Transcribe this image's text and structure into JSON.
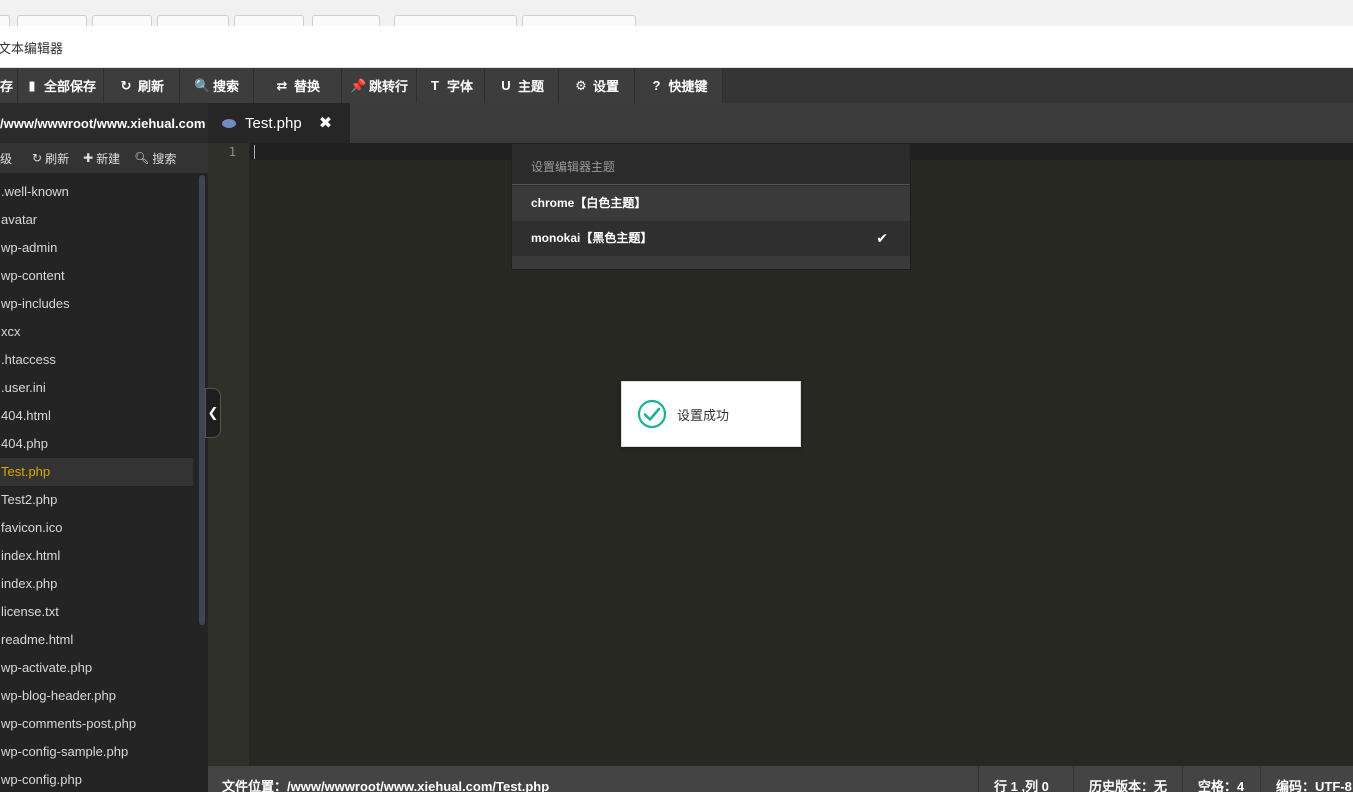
{
  "window": {
    "title": "文本编辑器"
  },
  "toolbar": [
    {
      "id": "save-all",
      "icon": "save-icon",
      "glyph": "▮",
      "label": "全部保存"
    },
    {
      "id": "refresh",
      "icon": "refresh-icon",
      "glyph": "↻",
      "label": "刷新"
    },
    {
      "id": "search",
      "icon": "search-icon",
      "glyph": "🔍",
      "label": "搜索"
    },
    {
      "id": "replace",
      "icon": "replace-icon",
      "glyph": "⇄",
      "label": "替换"
    },
    {
      "id": "goto-line",
      "icon": "pin-icon",
      "glyph": "📌",
      "label": "跳转行"
    },
    {
      "id": "font",
      "icon": "font-icon",
      "glyph": "T",
      "label": "字体"
    },
    {
      "id": "theme",
      "icon": "magnet-icon",
      "glyph": "U",
      "label": "主题"
    },
    {
      "id": "settings",
      "icon": "gear-icon",
      "glyph": "⚙",
      "label": "设置"
    },
    {
      "id": "shortcuts",
      "icon": "question-icon",
      "glyph": "?",
      "label": "快捷键"
    }
  ],
  "toolbar_first_label": "存",
  "sidebar": {
    "path": "/www/wwwroot/www.xiehual.com",
    "tools": {
      "up": "级",
      "refresh": "刷新",
      "new": "新建",
      "search": "搜索"
    },
    "files": [
      ".well-known",
      "avatar",
      "wp-admin",
      "wp-content",
      "wp-includes",
      "xcx",
      ".htaccess",
      ".user.ini",
      "404.html",
      "404.php",
      "Test.php",
      "Test2.php",
      "favicon.ico",
      "index.html",
      "index.php",
      "license.txt",
      "readme.html",
      "wp-activate.php",
      "wp-blog-header.php",
      "wp-comments-post.php",
      "wp-config-sample.php",
      "wp-config.php"
    ],
    "active_file": "Test.php"
  },
  "tab": {
    "label": "Test.php"
  },
  "editor": {
    "line_number": "1"
  },
  "theme_menu": {
    "header": "设置编辑器主题",
    "items": [
      {
        "label": "chrome【白色主题】",
        "selected": false
      },
      {
        "label": "monokai【黑色主题】",
        "selected": true
      }
    ]
  },
  "toast": {
    "message": "设置成功",
    "color": "#1ab394"
  },
  "status": {
    "path": "文件位置：/www/wwwroot/www.xiehual.com/Test.php",
    "position": "行 1 ,列 0",
    "history": "历史版本：无",
    "indent": "空格：4",
    "encoding": "编码：UTF-8"
  }
}
